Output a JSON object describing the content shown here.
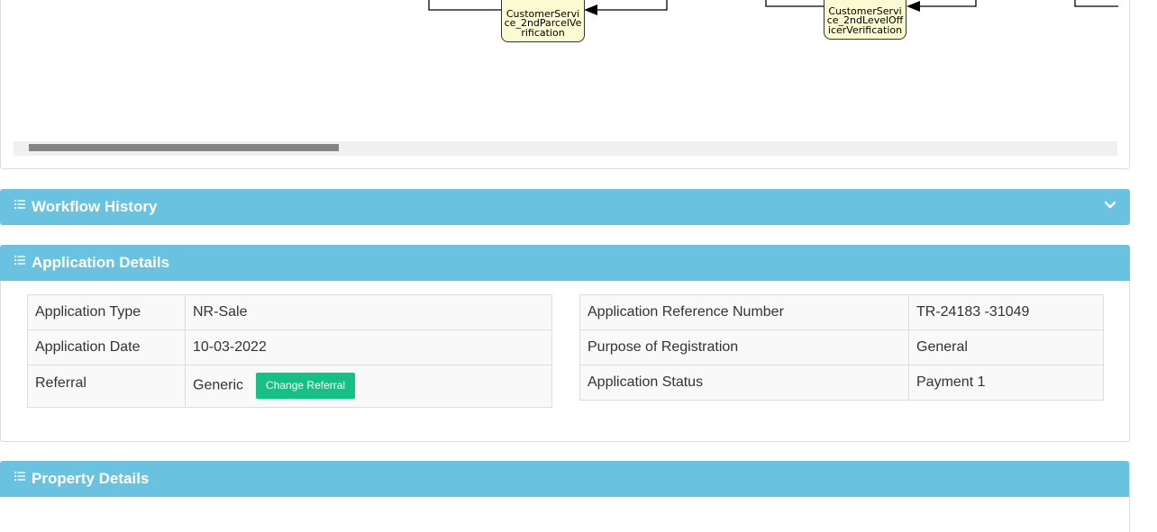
{
  "diagram": {
    "nodes": [
      {
        "label": "CustomerService_2ndParcelVerification"
      },
      {
        "label": "CustomerService_2ndLevelOfficerVerification"
      }
    ]
  },
  "workflow_history": {
    "title": "Workflow History",
    "icon": "list-icon",
    "toggle_icon": "chevron-down-icon"
  },
  "application_details": {
    "title": "Application Details",
    "icon": "list-icon",
    "left": [
      {
        "label": "Application Type",
        "value": "NR-Sale"
      },
      {
        "label": "Application Date",
        "value": "10-03-2022"
      },
      {
        "label": "Referral",
        "value": "Generic",
        "button": "Change Referral"
      }
    ],
    "right": [
      {
        "label": "Application Reference Number",
        "value": "TR-24183 -31049"
      },
      {
        "label": "Purpose of Registration",
        "value": "General"
      },
      {
        "label": "Application Status",
        "value": "Payment 1"
      }
    ]
  },
  "property_details": {
    "title": "Property Details",
    "icon": "list-icon"
  },
  "colors": {
    "header": "#69c3e0",
    "button": "#17bf86",
    "node_fill": "#fbfbd2"
  }
}
